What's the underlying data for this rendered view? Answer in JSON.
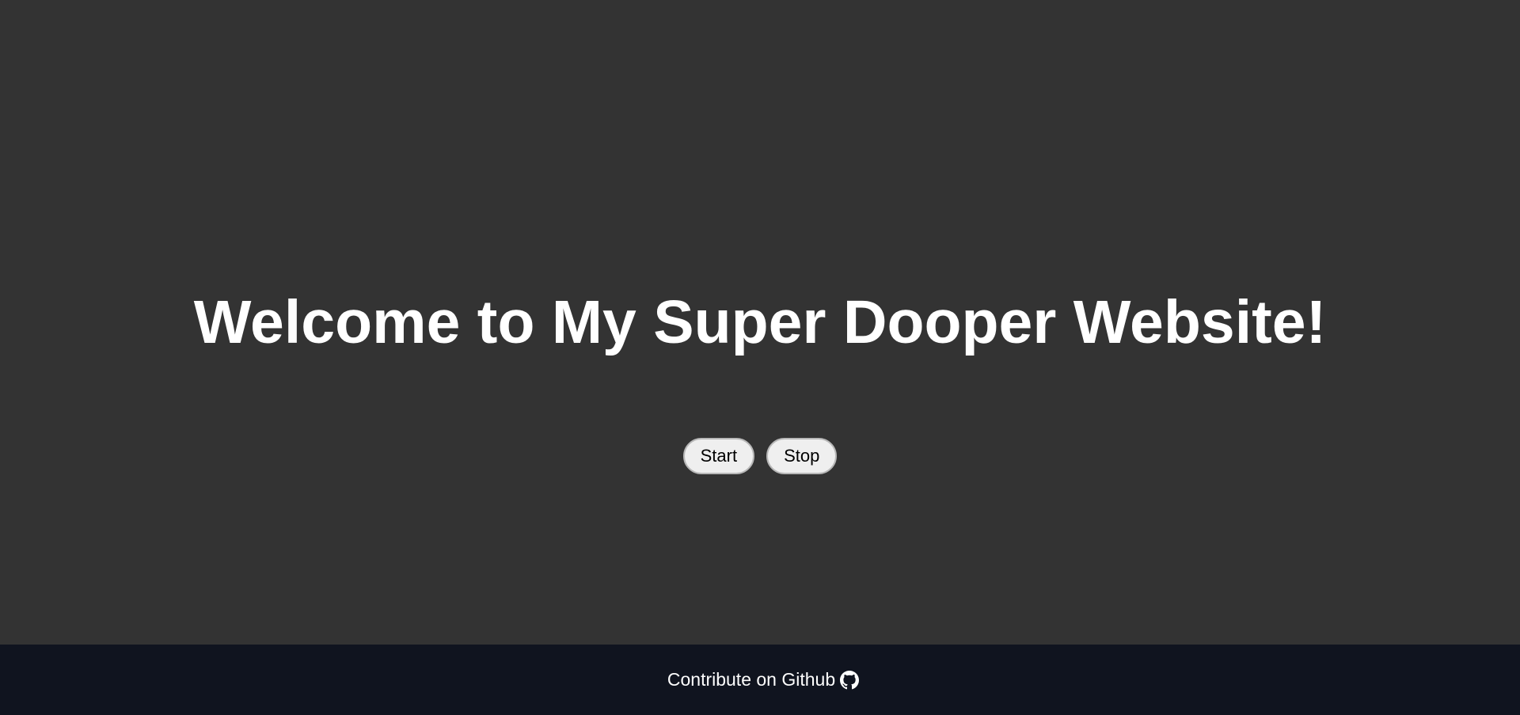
{
  "main": {
    "title": "Welcome to My Super Dooper Website!",
    "buttons": {
      "start_label": "Start",
      "stop_label": "Stop"
    }
  },
  "footer": {
    "link_text": "Contribute on Github",
    "icon": "github-icon"
  },
  "colors": {
    "background": "#333333",
    "footer_background": "#10141f",
    "title_text": "#ffffff",
    "button_background": "#efefef"
  }
}
